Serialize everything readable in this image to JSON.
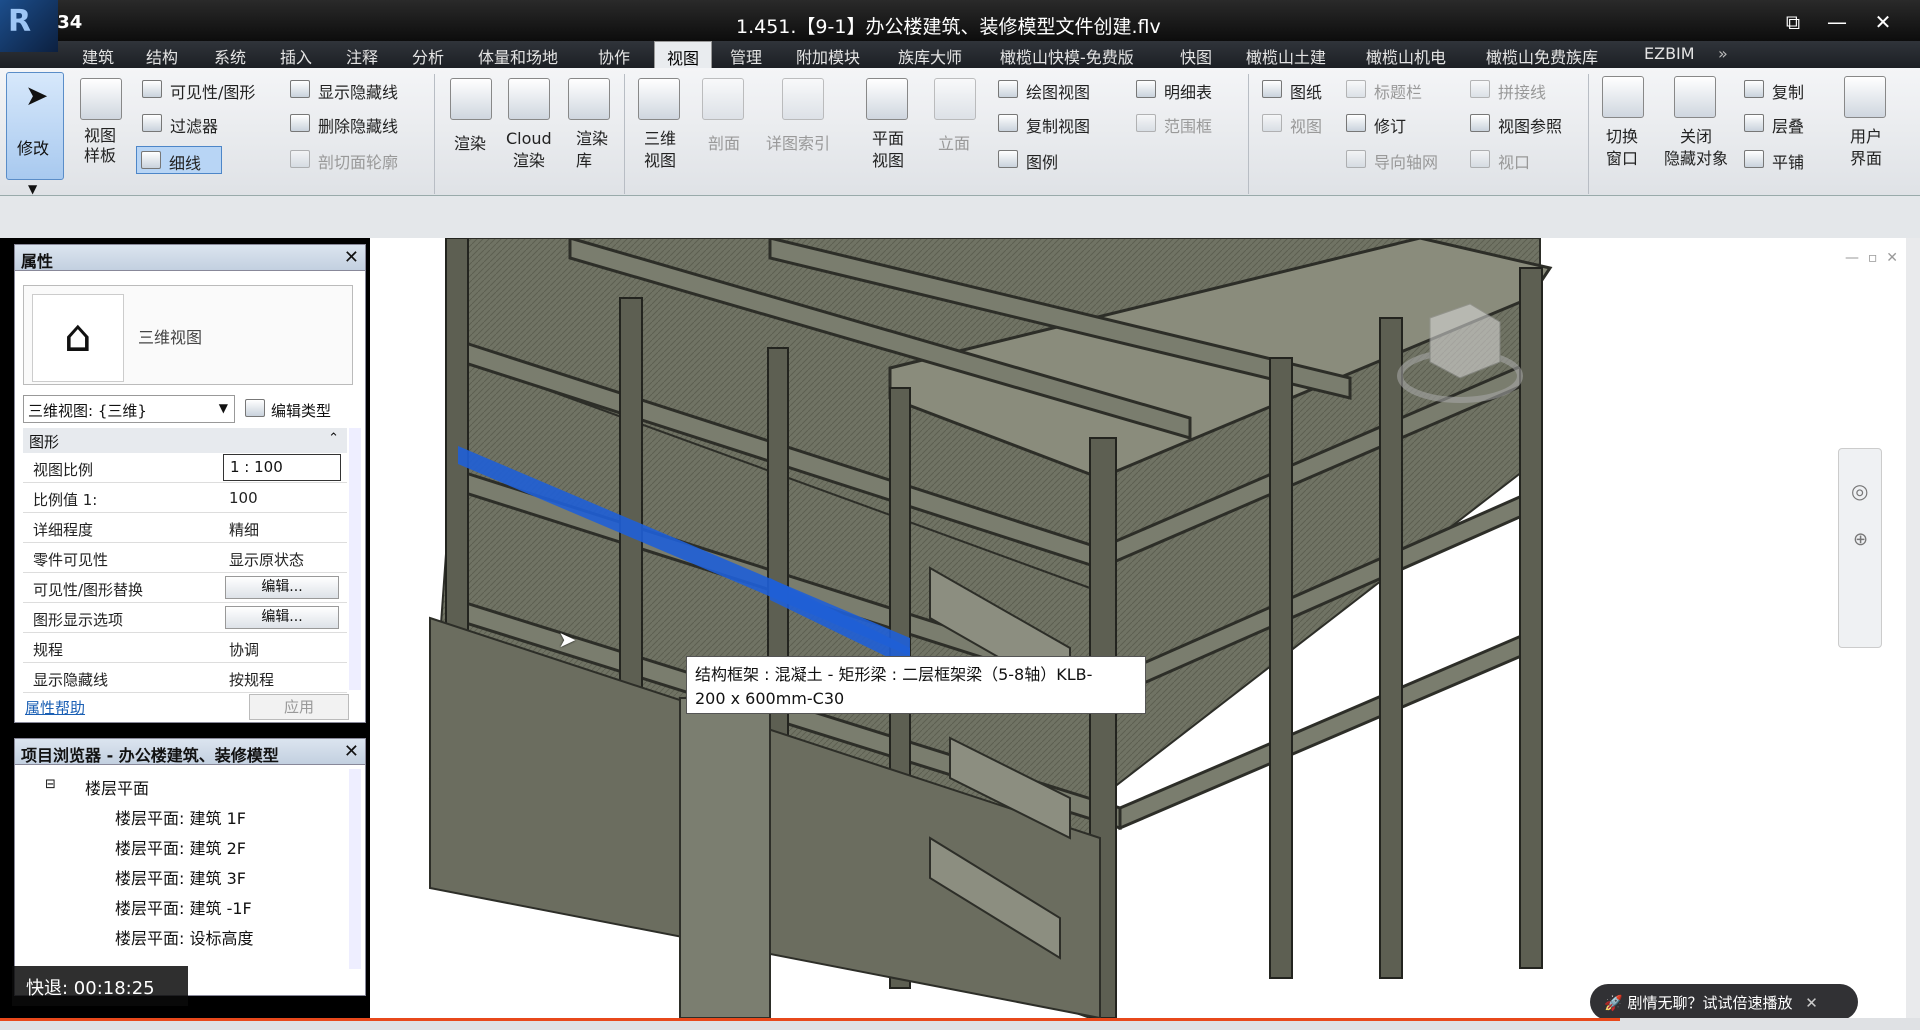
{
  "titlebar": {
    "clock": "12:34",
    "title": "1.451.【9-1】办公楼建筑、装修模型文件创建.flv",
    "logo": "R"
  },
  "menu_tabs": [
    "建筑",
    "结构",
    "系统",
    "插入",
    "注释",
    "分析",
    "体量和场地",
    "协作",
    "视图",
    "管理",
    "附加模块",
    "族库大师",
    "橄榄山快模-免费版",
    "快图",
    "橄榄山土建",
    "橄榄山机电",
    "橄榄山免费族库",
    "EZBIM"
  ],
  "active_tab": "视图",
  "ribbon": {
    "modify": "修改",
    "view_template": "视图\n样板",
    "vis_graphics": "可见性/图形",
    "filters": "过滤器",
    "thin_lines": "细线",
    "show_hidden": "显示隐藏线",
    "remove_hidden": "删除隐藏线",
    "cut_profile": "剖切面轮廓",
    "render": "渲染",
    "cloud_render": "Cloud\n渲染",
    "render_gallery": "渲染\n库",
    "view_3d": "三维\n视图",
    "section": "剖面",
    "callout": "详图索引",
    "plan_views": "平面\n视图",
    "elevation": "立面",
    "drafting_view": "绘图视图",
    "duplicate_view": "复制视图",
    "legends": "图例",
    "schedules": "明细表",
    "scope_box": "范围框",
    "sheet": "图纸",
    "view_on_sheet": "视图",
    "title_block": "标题栏",
    "revisions": "修订",
    "guide_grid": "导向轴网",
    "matchline": "拼接线",
    "view_reference": "视图参照",
    "viewports": "视口",
    "switch_windows": "切换\n窗口",
    "close_hidden": "关闭\n隐藏对象",
    "replicate": "复制",
    "cascade": "层叠",
    "tile": "平铺",
    "user_interface": "用户\n界面"
  },
  "properties": {
    "header": "属性",
    "type_name": "三维视图",
    "view_selector": "三维视图: {三维}",
    "edit_type": "编辑类型",
    "group": "图形",
    "rows": [
      {
        "label": "视图比例",
        "value": "1 : 100",
        "kind": "input"
      },
      {
        "label": "比例值 1:",
        "value": "100",
        "kind": "dim"
      },
      {
        "label": "详细程度",
        "value": "精细",
        "kind": "text"
      },
      {
        "label": "零件可见性",
        "value": "显示原状态",
        "kind": "text"
      },
      {
        "label": "可见性/图形替换",
        "value": "编辑...",
        "kind": "button"
      },
      {
        "label": "图形显示选项",
        "value": "编辑...",
        "kind": "button"
      },
      {
        "label": "规程",
        "value": "协调",
        "kind": "text"
      },
      {
        "label": "显示隐藏线",
        "value": "按规程",
        "kind": "text"
      }
    ],
    "help": "属性帮助",
    "apply": "应用"
  },
  "browser": {
    "header": "项目浏览器 - 办公楼建筑、装修模型",
    "root": "楼层平面",
    "items": [
      "楼层平面: 建筑 1F",
      "楼层平面: 建筑 2F",
      "楼层平面: 建筑 3F",
      "楼层平面: 建筑 -1F",
      "楼层平面: 设标高度"
    ]
  },
  "tooltip": {
    "line1": "结构框架 : 混凝土 - 矩形梁 : 二层框架梁（5-8轴）KLB-",
    "line2": "200 x 600mm-C30"
  },
  "overlay": {
    "speed": "快退: 00:18:25",
    "promo": "剧情无聊？试试倍速播放"
  },
  "colors": {
    "accent": "#1f5fd6",
    "progress": "#e8481b",
    "model_fill": "#6f7163",
    "model_edge": "#2d2e28"
  }
}
